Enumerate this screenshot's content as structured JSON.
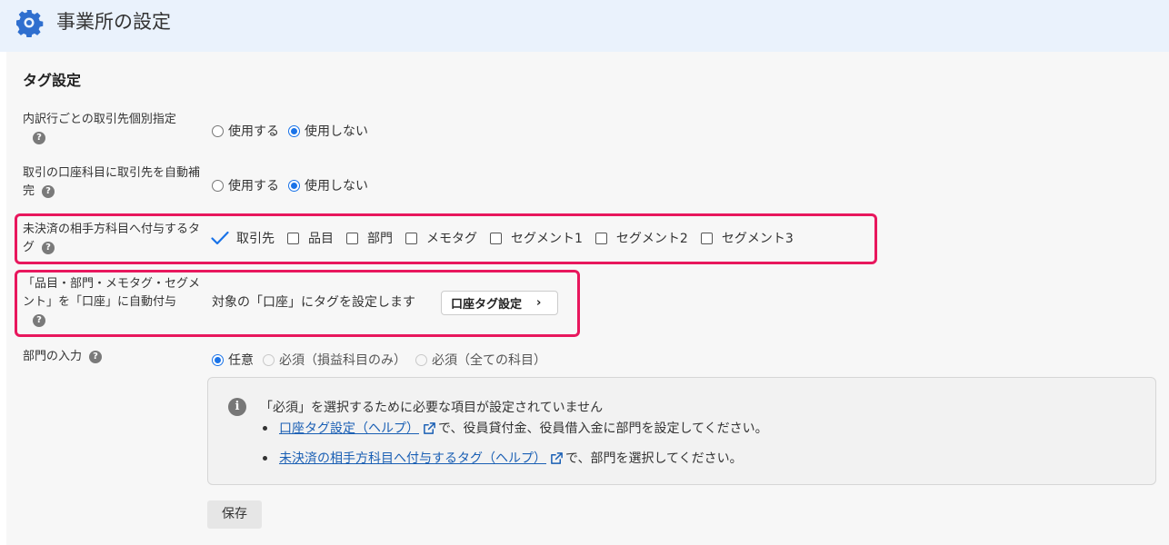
{
  "header": {
    "title": "事業所の設定",
    "icon": "gear-icon"
  },
  "section": {
    "title": "タグ設定"
  },
  "rows": {
    "partner_per_line": {
      "label": "内訳行ごとの取引先個別指定",
      "options": [
        {
          "label": "使用する",
          "selected": false
        },
        {
          "label": "使用しない",
          "selected": true
        }
      ]
    },
    "auto_complete": {
      "label_line1": "取引の口座科目に取引先を自動補",
      "label_line2": "完",
      "options": [
        {
          "label": "使用する",
          "selected": false
        },
        {
          "label": "使用しない",
          "selected": true
        }
      ]
    },
    "unsettled_tags": {
      "label_line1": "未決済の相手方科目へ付与するタ",
      "label_line2": "グ",
      "checks": [
        {
          "label": "取引先",
          "checked": true
        },
        {
          "label": "品目",
          "checked": false
        },
        {
          "label": "部門",
          "checked": false
        },
        {
          "label": "メモタグ",
          "checked": false
        },
        {
          "label": "セグメント1",
          "checked": false
        },
        {
          "label": "セグメント2",
          "checked": false
        },
        {
          "label": "セグメント3",
          "checked": false
        }
      ]
    },
    "account_auto_tag": {
      "label_line1": "「品目・部門・メモタグ・セグメ",
      "label_line2": "ント」を「口座」に自動付与",
      "description": "対象の「口座」にタグを設定します",
      "button": "口座タグ設定",
      "button_chevron": "›"
    },
    "department_input": {
      "label": "部門の入力",
      "options": [
        {
          "label": "任意",
          "selected": true,
          "disabled": false
        },
        {
          "label": "必須（損益科目のみ）",
          "selected": false,
          "disabled": true
        },
        {
          "label": "必須（全ての科目）",
          "selected": false,
          "disabled": true
        }
      ]
    }
  },
  "info": {
    "heading": "「必須」を選択するために必要な項目が設定されていません",
    "items": [
      {
        "link": "口座タグ設定（ヘルプ）",
        "text": "で、役員貸付金、役員借入金に部門を設定してください。"
      },
      {
        "link": "未決済の相手方科目へ付与するタグ（ヘルプ）",
        "text": "で、部門を選択してください。"
      }
    ]
  },
  "save_label": "保存",
  "help_glyph": "?",
  "info_glyph": "i",
  "colors": {
    "accent": "#1a73e8",
    "highlight": "#e8175d",
    "header_bg": "#eaf2fc"
  }
}
